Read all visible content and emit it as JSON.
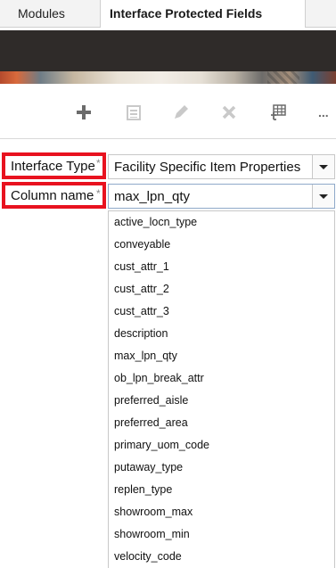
{
  "tabs": {
    "modules": "Modules",
    "current": "Interface Protected Fields"
  },
  "toolbar": {
    "icons": [
      "add-icon",
      "copy-icon",
      "edit-icon",
      "delete-icon",
      "grid-settings-icon",
      "more-icon"
    ],
    "more_label": "..."
  },
  "form": {
    "interface_type": {
      "label": "Interface Type",
      "required_mark": "*",
      "value": "Facility Specific Item Properties"
    },
    "column_name": {
      "label": "Column name",
      "required_mark": "*",
      "value": "max_lpn_qty",
      "options": [
        "active_locn_type",
        "conveyable",
        "cust_attr_1",
        "cust_attr_2",
        "cust_attr_3",
        "description",
        "max_lpn_qty",
        "ob_lpn_break_attr",
        "preferred_aisle",
        "preferred_area",
        "primary_uom_code",
        "putaway_type",
        "replen_type",
        "showroom_max",
        "showroom_min",
        "velocity_code"
      ]
    }
  },
  "colors": {
    "highlight": "#e8121f",
    "banner": "#2f2b29",
    "icon_active": "#6b6b6b",
    "icon_disabled": "#c9c9c9"
  }
}
